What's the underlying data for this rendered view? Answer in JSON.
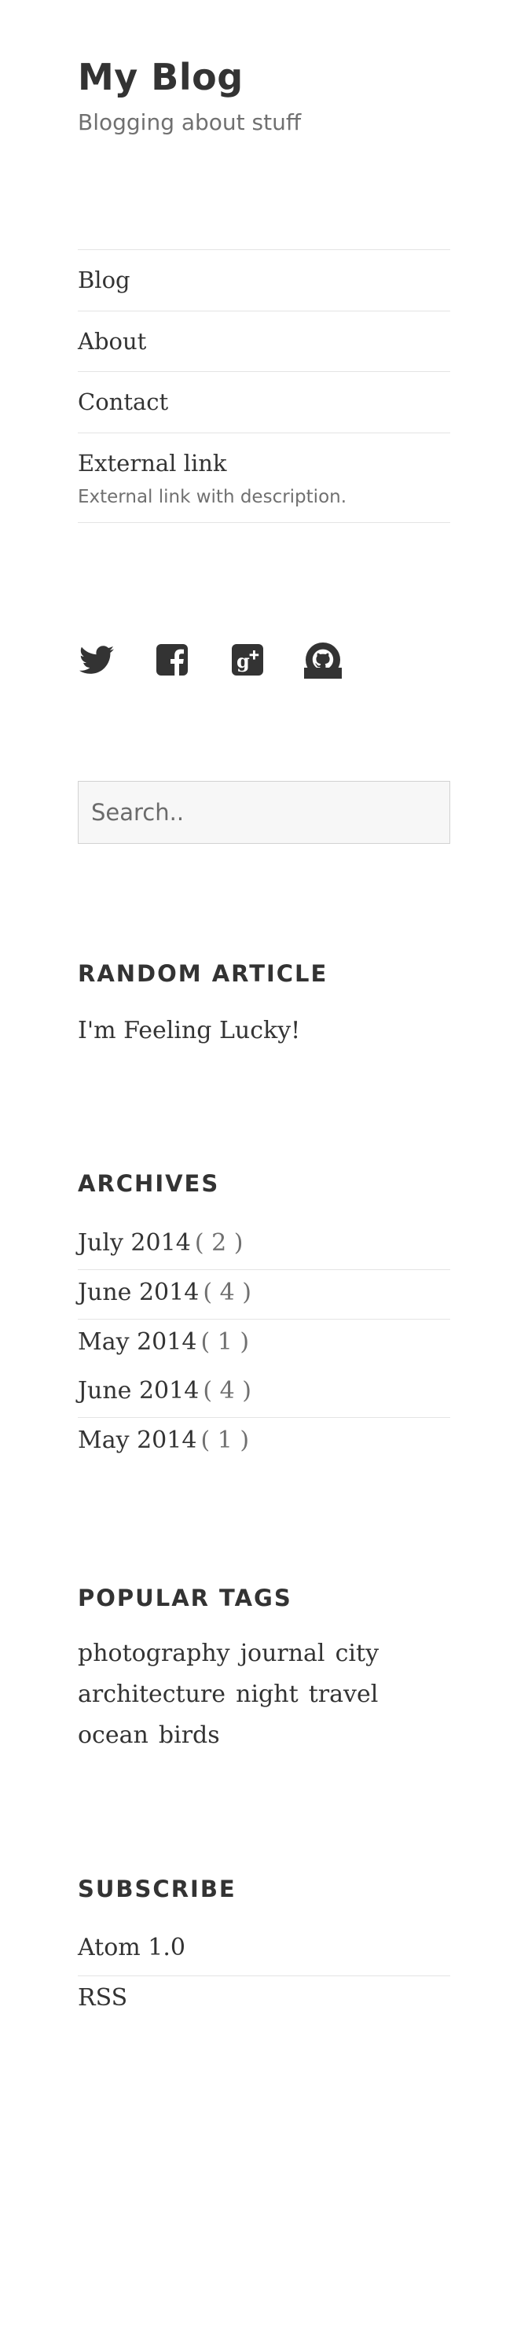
{
  "site": {
    "title": "My Blog",
    "description": "Blogging about stuff"
  },
  "nav": {
    "items": [
      {
        "label": "Blog"
      },
      {
        "label": "About"
      },
      {
        "label": "Contact"
      },
      {
        "label": "External link",
        "description": "External link with description."
      }
    ]
  },
  "social": {
    "icons": [
      "twitter-icon",
      "facebook-icon",
      "google-plus-icon",
      "github-icon"
    ]
  },
  "search": {
    "placeholder": "Search.."
  },
  "random_article": {
    "title": "RANDOM ARTICLE",
    "link": "I'm Feeling Lucky!"
  },
  "archives": {
    "title": "ARCHIVES",
    "items": [
      {
        "label": "July 2014",
        "count": "( 2 )"
      },
      {
        "label": "June 2014",
        "count": "( 4 )"
      },
      {
        "label": "May 2014",
        "count": "( 1 )"
      },
      {
        "label": "June 2014",
        "count": "( 4 )"
      },
      {
        "label": "May 2014",
        "count": "( 1 )"
      }
    ]
  },
  "popular_tags": {
    "title": "POPULAR TAGS",
    "tags": [
      "photography",
      "journal",
      "city",
      "architecture",
      "night",
      "travel",
      "ocean",
      "birds"
    ]
  },
  "subscribe": {
    "title": "SUBSCRIBE",
    "items": [
      "Atom 1.0",
      "RSS"
    ]
  },
  "colors": {
    "text": "#333333",
    "muted": "#707070",
    "border": "#e4e4e4",
    "input_bg": "#f7f7f7"
  }
}
